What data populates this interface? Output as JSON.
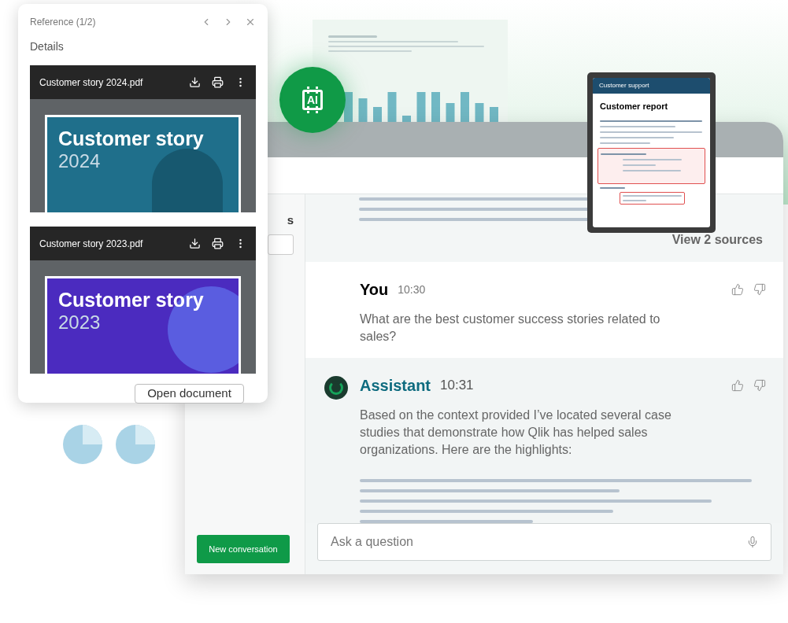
{
  "reference_panel": {
    "title": "Reference (1/2)",
    "subtitle": "Details",
    "button": "Open document",
    "documents": [
      {
        "filename": "Customer story 2024.pdf",
        "cover_title": "Customer story",
        "cover_year": "2024",
        "kind": "photo"
      },
      {
        "filename": "Customer story 2023.pdf",
        "cover_title": "Customer story",
        "cover_year": "2023",
        "kind": "shapes"
      }
    ]
  },
  "ai_badge": {
    "label": "AI"
  },
  "source_preview": {
    "header": "Customer support",
    "title": "Customer report"
  },
  "sidebar": {
    "heading_fragment": "s",
    "button": "New conversation"
  },
  "chat": {
    "sources_link": "View 2 sources",
    "messages": [
      {
        "kind": "user",
        "author": "You",
        "time": "10:30",
        "text": "What are the best customer success stories related to sales?"
      },
      {
        "kind": "assistant",
        "author": "Assistant",
        "time": "10:31",
        "text": "Based on the context provided I’ve located several case studies that demonstrate how Qlik has helped sales organizations. Here are the highlights:"
      }
    ],
    "input": {
      "placeholder": "Ask a question"
    }
  }
}
